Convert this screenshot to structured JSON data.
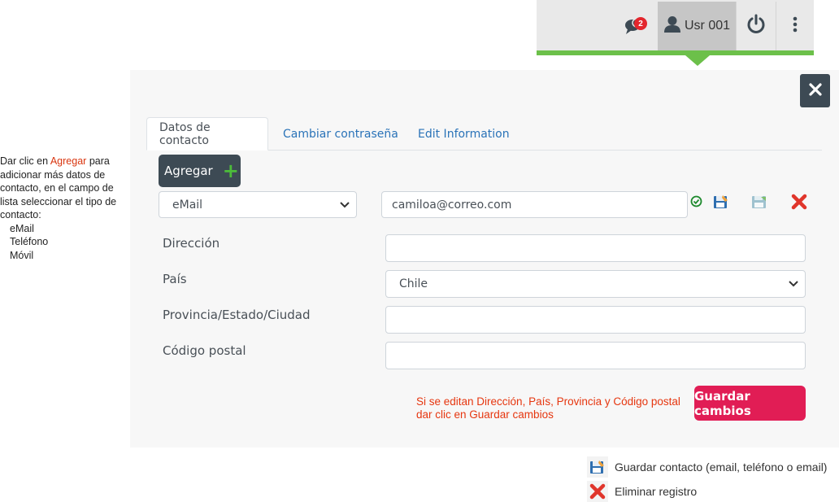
{
  "topbar": {
    "notifications": {
      "icon": "chat-bubbles-icon",
      "count": "2"
    },
    "user": {
      "icon": "user-icon",
      "label": "Usr 001"
    },
    "power": {
      "icon": "power-icon"
    },
    "menu": {
      "icon": "vertical-dots-icon"
    },
    "accent_color": "#6cc04a"
  },
  "modal": {
    "close_icon": "close-icon",
    "tabs": [
      {
        "label": "Datos de contacto",
        "active": true
      },
      {
        "label": "Cambiar contraseña",
        "active": false
      },
      {
        "label": "Edit Information",
        "active": false
      }
    ],
    "add_button": {
      "label": "Agregar",
      "icon": "plus-icon"
    },
    "contact_row": {
      "type_value": "eMail",
      "value": "camiloa@correo.com",
      "actions": [
        "check-circle-icon",
        "save-contact-icon",
        "save-disabled-icon",
        "delete-x-icon"
      ]
    },
    "fields": [
      {
        "label": "Dirección",
        "value": ""
      },
      {
        "label": "País",
        "value": "Chile"
      },
      {
        "label": "Provincia/Estado/Ciudad",
        "value": ""
      },
      {
        "label": "Código postal",
        "value": ""
      }
    ],
    "save_note": "Si se editan Dirección, País, Provincia y Código postal dar clic en Guardar cambios",
    "save_button": "Guardar cambios",
    "save_button_color": "#e11d55"
  },
  "side_note": {
    "prefix": "Dar clic en ",
    "highlight": "Agregar",
    "rest": "para adicionar más datos de contacto, en el campo de lista seleccionar el tipo de contacto:",
    "options": [
      "eMail",
      "Teléfono",
      "Móvil"
    ]
  },
  "legend": [
    {
      "icon": "save-contact-icon",
      "text": "Guardar contacto (email, teléfono o email)"
    },
    {
      "icon": "delete-x-icon",
      "text": "Eliminar registro"
    }
  ]
}
